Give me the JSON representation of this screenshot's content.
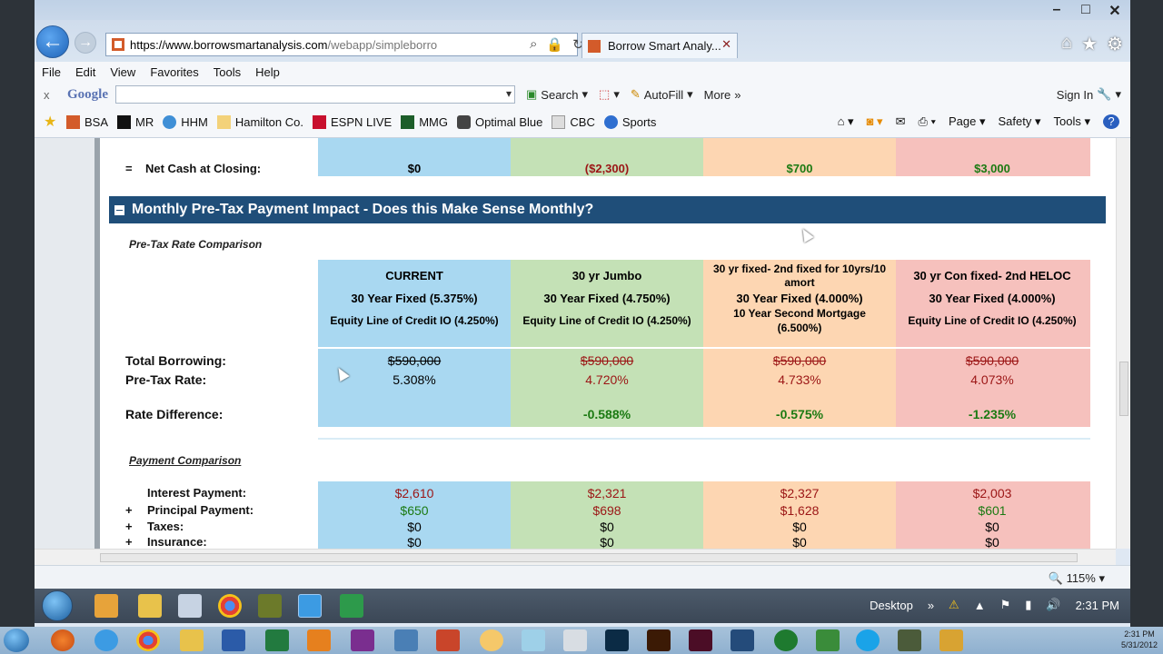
{
  "browser": {
    "url_host": "https://www.borrowsmartanalysis.com",
    "url_path": "/webapp/simpleborro",
    "tab_title": "Borrow Smart Analy...",
    "tab_close": "✕"
  },
  "menu": [
    "File",
    "Edit",
    "View",
    "Favorites",
    "Tools",
    "Help"
  ],
  "google_bar": {
    "close": "x",
    "logo": "Google",
    "search": "Search",
    "autofill": "AutoFill",
    "more": "More",
    "signin": "Sign In"
  },
  "favorites": [
    "BSA",
    "MR",
    "HHM",
    "Hamilton Co.",
    "ESPN LIVE",
    "MMG",
    "Optimal Blue",
    "CBC",
    "Sports"
  ],
  "fav_right": {
    "page": "Page",
    "safety": "Safety",
    "tools": "Tools"
  },
  "net_cash": {
    "prefix": "=",
    "label": "Net Cash at Closing:",
    "values": [
      "$0",
      "($2,300)",
      "$700",
      "$3,000"
    ]
  },
  "section": {
    "title": "Monthly Pre-Tax Payment Impact - Does this Make Sense Monthly?"
  },
  "pretax": {
    "subhead": "Pre-Tax Rate Comparison",
    "columns": [
      {
        "title": "CURRENT",
        "line1": "30 Year Fixed (5.375%)",
        "line2": "Equity Line of Credit IO (4.250%)",
        "line3": ""
      },
      {
        "title": "30 yr Jumbo",
        "line1": "30 Year Fixed (4.750%)",
        "line2": "Equity Line of Credit IO (4.250%)",
        "line3": ""
      },
      {
        "title": "30 yr fixed- 2nd fixed for 10yrs/10 amort",
        "line1": "30 Year Fixed (4.000%)",
        "line2": "10 Year Second Mortgage",
        "line3": "(6.500%)"
      },
      {
        "title": "30 yr Con fixed- 2nd HELOC",
        "line1": "30 Year Fixed (4.000%)",
        "line2": "Equity Line of Credit IO (4.250%)",
        "line3": ""
      }
    ],
    "labels": {
      "total_borrowing": "Total Borrowing:",
      "pretax_rate": "Pre-Tax Rate:",
      "rate_diff": "Rate Difference:"
    },
    "total_borrowing": [
      "$590,000",
      "$590,000",
      "$590,000",
      "$590,000"
    ],
    "pretax_rate": [
      "5.308%",
      "4.720%",
      "4.733%",
      "4.073%"
    ],
    "rate_diff": [
      "",
      "-0.588%",
      "-0.575%",
      "-1.235%"
    ]
  },
  "payment": {
    "subhead": "Payment Comparison",
    "rows": [
      {
        "sign": "",
        "label": "Interest Payment:",
        "values": [
          "$2,610",
          "$2,321",
          "$2,327",
          "$2,003"
        ]
      },
      {
        "sign": "+",
        "label": "Principal Payment:",
        "values": [
          "$650",
          "$698",
          "$1,628",
          "$601"
        ]
      },
      {
        "sign": "+",
        "label": "Taxes:",
        "values": [
          "$0",
          "$0",
          "$0",
          "$0"
        ]
      },
      {
        "sign": "+",
        "label": "Insurance:",
        "values": [
          "$0",
          "$0",
          "$0",
          "$0"
        ]
      }
    ]
  },
  "status": {
    "zoom": "115%"
  },
  "inner_taskbar": {
    "desktop": "Desktop",
    "time": "2:31 PM"
  },
  "outer_taskbar": {
    "time": "2:31 PM",
    "date": "5/31/2012"
  },
  "colors": {
    "header": "#1f4e79",
    "blue": "#a9d8f1",
    "green": "#c4e1b6",
    "orange": "#fdd6b2",
    "red": "#f6c1bd"
  }
}
